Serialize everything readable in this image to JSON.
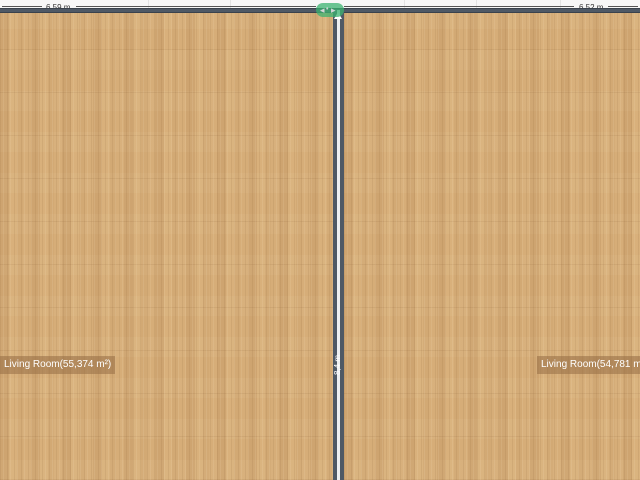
{
  "walls": {
    "top_left_length": "6,59 m",
    "top_right_length": "6,52 m",
    "divider_length": "8,4 m"
  },
  "rooms": [
    {
      "label": "Living Room(55,374 m²)"
    },
    {
      "label": "Living Room(54,781 m"
    }
  ],
  "icons": {
    "wall_handle": "resize-handle-icon",
    "wall_direction": "arrow-up-icon"
  },
  "colors": {
    "floor": "#d6ad78",
    "wall": "#4f5965",
    "handle": "#3cb371"
  }
}
